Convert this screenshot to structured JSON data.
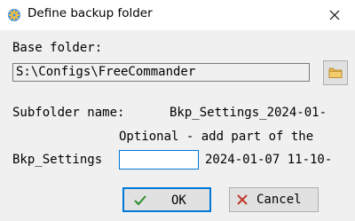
{
  "window": {
    "title": "Define backup folder",
    "app_icon": "gear-icon",
    "close_icon": "close-icon"
  },
  "base_folder": {
    "label": "Base folder:",
    "value": "S:\\Configs\\FreeCommander",
    "browse_icon": "folder-icon"
  },
  "subfolder": {
    "label": "Subfolder name:",
    "value": "Bkp_Settings_2024-01-"
  },
  "optional_hint": "Optional - add part of the",
  "name_row": {
    "prefix": "Bkp_Settings",
    "input_value": "",
    "timestamp": "2024-01-07 11-10-"
  },
  "buttons": {
    "ok_label": "OK",
    "ok_icon": "checkmark-icon",
    "cancel_label": "Cancel",
    "cancel_icon": "x-icon"
  },
  "colors": {
    "accent": "#0078d7",
    "ok_icon": "#2e8b2e",
    "cancel_icon": "#c0392b",
    "folder_icon": "#e8b64c"
  }
}
